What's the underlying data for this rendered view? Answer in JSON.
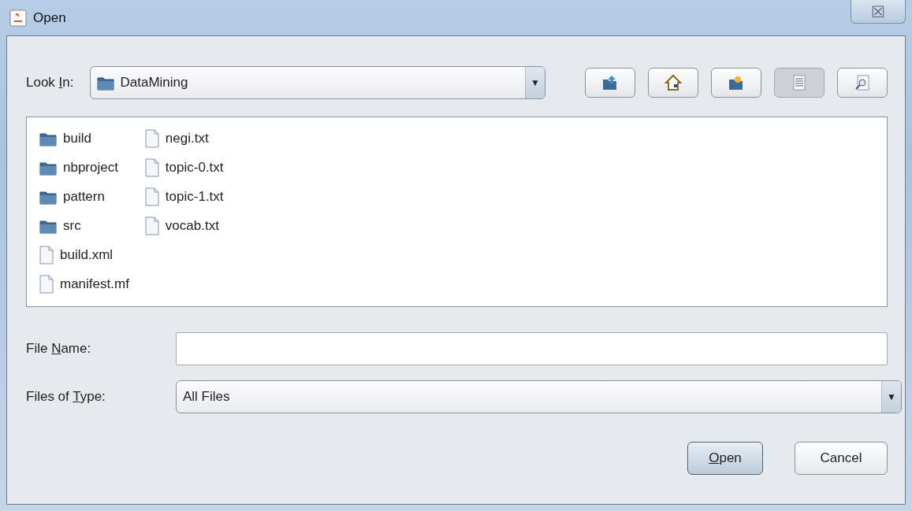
{
  "window": {
    "title": "Open",
    "close_label": "☒"
  },
  "look_in": {
    "label": {
      "pre": "Look ",
      "key": "I",
      "post": "n:"
    },
    "value": "DataMining",
    "arrow": "▼"
  },
  "toolbar": [
    {
      "kind": "up",
      "selected": false
    },
    {
      "kind": "home",
      "selected": false
    },
    {
      "kind": "new-folder",
      "selected": false
    },
    {
      "kind": "list",
      "selected": true
    },
    {
      "kind": "details",
      "selected": false
    }
  ],
  "files": [
    {
      "name": "build",
      "kind": "folder",
      "selected": false
    },
    {
      "name": "nbproject",
      "kind": "folder",
      "selected": false
    },
    {
      "name": "pattern",
      "kind": "folder",
      "selected": false
    },
    {
      "name": "src",
      "kind": "folder",
      "selected": false
    },
    {
      "name": "build.xml",
      "kind": "file",
      "selected": false
    },
    {
      "name": "manifest.mf",
      "kind": "file",
      "selected": false
    },
    {
      "name": "negi.txt",
      "kind": "file",
      "selected": false
    },
    {
      "name": "topic-0.txt",
      "kind": "file",
      "selected": false
    },
    {
      "name": "topic-1.txt",
      "kind": "file",
      "selected": false
    },
    {
      "name": "vocab.txt",
      "kind": "file",
      "selected": false
    }
  ],
  "file_name": {
    "label": {
      "pre": "File ",
      "key": "N",
      "post": "ame:"
    }
  },
  "files_of_type": {
    "label": {
      "pre": "Files of ",
      "key": "T",
      "post": "ype:"
    },
    "value": "All Files",
    "arrow": "▼"
  },
  "buttons": [
    {
      "label": {
        "key": "O",
        "post": "pen"
      },
      "default": true
    },
    {
      "label": {
        "post": "Cancel"
      },
      "default": false
    }
  ]
}
